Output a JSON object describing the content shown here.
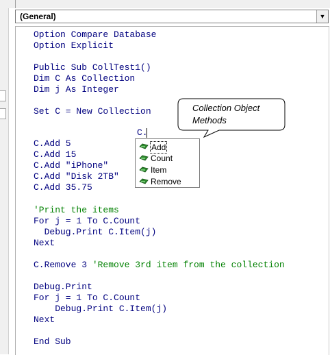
{
  "procedure_combo": {
    "value": "(General)",
    "dropdown_icon": "triangle-down"
  },
  "code_lines": [
    "Option Compare Database",
    "Option Explicit",
    "Public Sub CollTest1()",
    "Dim C As Collection",
    "Dim j As Integer",
    "Set C = New Collection",
    "C.",
    "C.Add 5",
    "C.Add 15",
    "C.Add \"iPhone\"",
    "C.Add \"Disk 2TB\"",
    "C.Add 35.75",
    "'Print the items",
    "For j = 1 To C.Count",
    "  Debug.Print C.Item(j)",
    "Next",
    "C.Remove 3 ",
    "'Remove 3rd item from the collection",
    "Debug.Print",
    "For j = 1 To C.Count",
    "    Debug.Print C.Item(j)",
    "Next",
    "End Sub"
  ],
  "callout": {
    "line1": "Collection Object",
    "line2": "Methods"
  },
  "intellisense": {
    "items": [
      {
        "label": "Add",
        "icon": "method-icon",
        "selected": true
      },
      {
        "label": "Count",
        "icon": "method-icon",
        "selected": false
      },
      {
        "label": "Item",
        "icon": "method-icon",
        "selected": false
      },
      {
        "label": "Remove",
        "icon": "method-icon",
        "selected": false
      }
    ]
  },
  "colors": {
    "keyword": "#00007f",
    "comment": "#008000",
    "method_icon": "#2e8b2e"
  }
}
